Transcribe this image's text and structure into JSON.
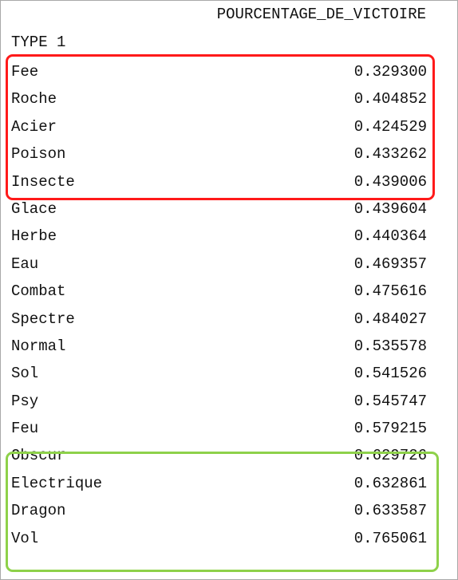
{
  "table": {
    "column_header": "POURCENTAGE_DE_VICTOIRE",
    "index_name": "TYPE 1",
    "rows": [
      {
        "type": "Fee",
        "value": "0.329300"
      },
      {
        "type": "Roche",
        "value": "0.404852"
      },
      {
        "type": "Acier",
        "value": "0.424529"
      },
      {
        "type": "Poison",
        "value": "0.433262"
      },
      {
        "type": "Insecte",
        "value": "0.439006"
      },
      {
        "type": "Glace",
        "value": "0.439604"
      },
      {
        "type": "Herbe",
        "value": "0.440364"
      },
      {
        "type": "Eau",
        "value": "0.469357"
      },
      {
        "type": "Combat",
        "value": "0.475616"
      },
      {
        "type": "Spectre",
        "value": "0.484027"
      },
      {
        "type": "Normal",
        "value": "0.535578"
      },
      {
        "type": "Sol",
        "value": "0.541526"
      },
      {
        "type": "Psy",
        "value": "0.545747"
      },
      {
        "type": "Feu",
        "value": "0.579215"
      },
      {
        "type": "Obscur",
        "value": "0.629726"
      },
      {
        "type": "Electrique",
        "value": "0.632861"
      },
      {
        "type": "Dragon",
        "value": "0.633587"
      },
      {
        "type": "Vol",
        "value": "0.765061"
      }
    ]
  },
  "highlights": {
    "lowest_rows_color": "#ff1a1a",
    "highest_rows_color": "#8ed14a"
  }
}
